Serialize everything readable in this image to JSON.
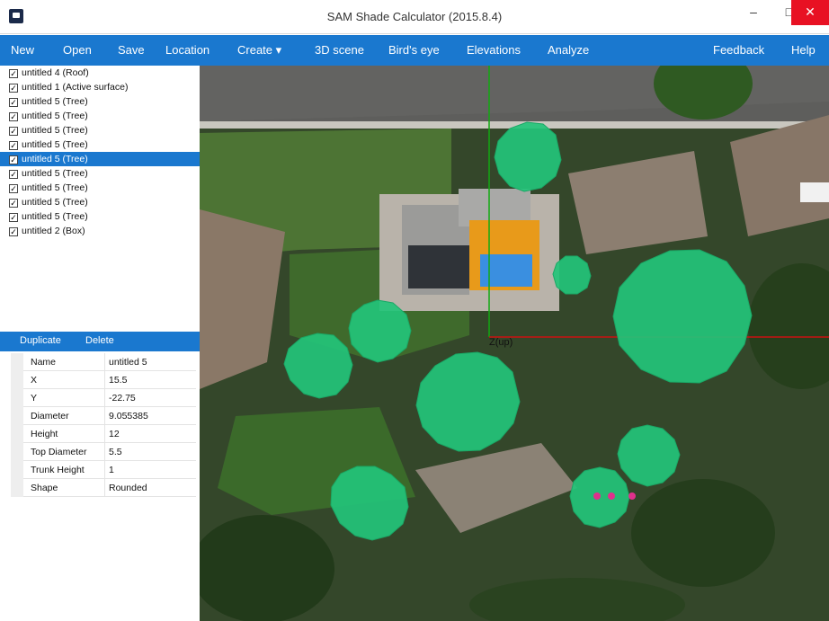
{
  "window": {
    "title": "SAM Shade Calculator (2015.8.4)",
    "minimize": "–",
    "maximize": "□",
    "close": "✕"
  },
  "menu": [
    {
      "label": "New"
    },
    {
      "label": "Open"
    },
    {
      "label": "Save"
    },
    {
      "label": "Location"
    },
    {
      "label": "Create ▾"
    },
    {
      "label": "3D scene"
    },
    {
      "label": "Bird's eye"
    },
    {
      "label": "Elevations"
    },
    {
      "label": "Analyze"
    },
    {
      "label": "Feedback"
    },
    {
      "label": "Help"
    }
  ],
  "layers": [
    {
      "label": "untitled 4 (Roof)",
      "checked": true
    },
    {
      "label": "untitled 1 (Active surface)",
      "checked": true
    },
    {
      "label": "untitled 5 (Tree)",
      "checked": true
    },
    {
      "label": "untitled 5 (Tree)",
      "checked": true
    },
    {
      "label": "untitled 5 (Tree)",
      "checked": true
    },
    {
      "label": "untitled 5 (Tree)",
      "checked": true
    },
    {
      "label": "untitled 5 (Tree)",
      "checked": true,
      "selected": true
    },
    {
      "label": "untitled 5 (Tree)",
      "checked": true
    },
    {
      "label": "untitled 5 (Tree)",
      "checked": true
    },
    {
      "label": "untitled 5 (Tree)",
      "checked": true
    },
    {
      "label": "untitled 5 (Tree)",
      "checked": true
    },
    {
      "label": "untitled 2 (Box)",
      "checked": true
    }
  ],
  "actions": {
    "duplicate": "Duplicate",
    "delete": "Delete"
  },
  "properties": [
    {
      "name": "Name",
      "value": "untitled 5"
    },
    {
      "name": "X",
      "value": "15.5"
    },
    {
      "name": "Y",
      "value": "-22.75"
    },
    {
      "name": "Diameter",
      "value": "9.055385"
    },
    {
      "name": "Height",
      "value": "12"
    },
    {
      "name": "Top Diameter",
      "value": "5.5"
    },
    {
      "name": "Trunk Height",
      "value": "1"
    },
    {
      "name": "Shape",
      "value": "Rounded"
    }
  ],
  "scene": {
    "axis_label": "Z(up)",
    "colors": {
      "tree": "#23c47a",
      "roof_orange": "#e89a1a",
      "pool": "#3a8fe0",
      "x_axis": "#cc1111",
      "y_axis": "#11aa11",
      "handle": "#e0308c"
    }
  }
}
